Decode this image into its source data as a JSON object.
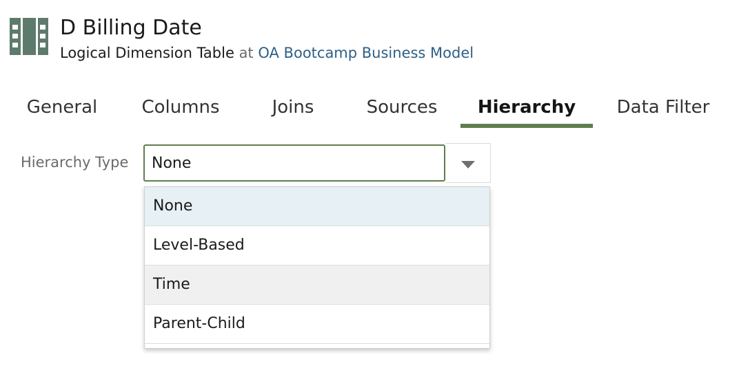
{
  "header": {
    "title": "D Billing Date",
    "object_type": "Logical Dimension Table",
    "at_word": "at",
    "business_model": "OA Bootcamp Business Model",
    "icon": "logical-table-icon"
  },
  "tabs": [
    {
      "label": "General"
    },
    {
      "label": "Columns"
    },
    {
      "label": "Joins"
    },
    {
      "label": "Sources"
    },
    {
      "label": "Hierarchy",
      "active": true
    },
    {
      "label": "Data Filter"
    }
  ],
  "hierarchy_type": {
    "label": "Hierarchy Type",
    "value": "None",
    "options": [
      {
        "label": "None",
        "selected": true
      },
      {
        "label": "Level-Based"
      },
      {
        "label": "Time",
        "hovered": true
      },
      {
        "label": "Parent-Child"
      }
    ]
  },
  "colors": {
    "accent_green": "#5f7d4f",
    "link_blue": "#2e5f86",
    "selected_option_bg": "#e6f0f5",
    "hover_option_bg": "#f0f0f0",
    "icon_green": "#5d7b6c"
  }
}
